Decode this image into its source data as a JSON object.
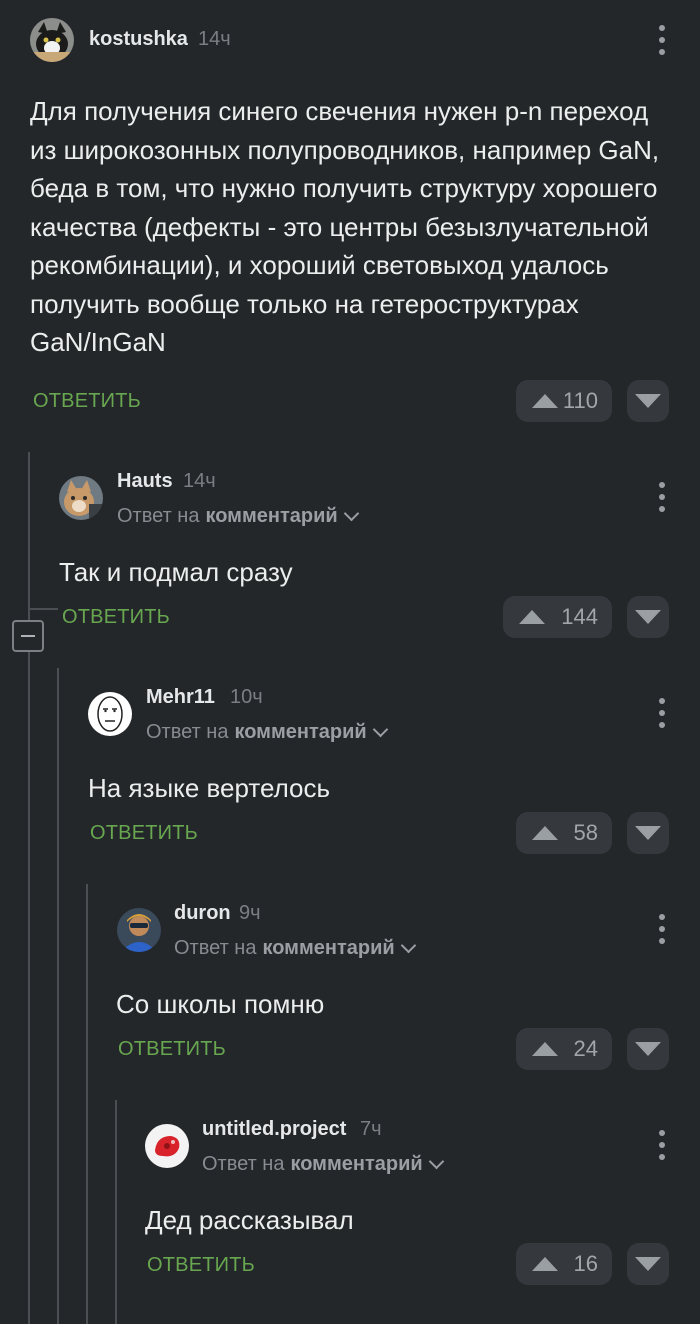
{
  "comments": [
    {
      "username": "kostushka",
      "time": "14ч",
      "text": "Для получения синего свечения нужен p-n переход из широкозонных полупроводников, например GaN, беда в том, что нужно получить структуру хорошего качества (дефекты - это центры безызлучательной рекомбинации), и хороший световыход удалось получить вообще только на гетероструктурах GaN/InGaN",
      "reply_label": "ОТВЕТИТЬ",
      "rating": "110"
    },
    {
      "username": "Hauts",
      "time": "14ч",
      "reply_to_prefix": "Ответ на",
      "reply_to_target": "комментарий",
      "text": "Так и подмал сразу",
      "reply_label": "ОТВЕТИТЬ",
      "rating": "144"
    },
    {
      "username": "Mehr11",
      "time": "10ч",
      "reply_to_prefix": "Ответ на",
      "reply_to_target": "комментарий",
      "text": "На языке вертелось",
      "reply_label": "ОТВЕТИТЬ",
      "rating": "58"
    },
    {
      "username": "duron",
      "time": "9ч",
      "reply_to_prefix": "Ответ на",
      "reply_to_target": "комментарий",
      "text": "Со школы помню",
      "reply_label": "ОТВЕТИТЬ",
      "rating": "24"
    },
    {
      "username": "untitled.project",
      "time": "7ч",
      "reply_to_prefix": "Ответ на",
      "reply_to_target": "комментарий",
      "text": "Дед рассказывал",
      "reply_label": "ОТВЕТИТЬ",
      "rating": "16"
    }
  ],
  "icons": {
    "more": "more-vertical-icon",
    "upvote": "arrow-up-icon",
    "downvote": "arrow-down-icon",
    "collapse": "minus-icon",
    "expand_reply": "chevron-down-icon"
  },
  "colors": {
    "background": "#23272a",
    "accent_green": "#68a74f",
    "vote_bg": "#35393d"
  }
}
